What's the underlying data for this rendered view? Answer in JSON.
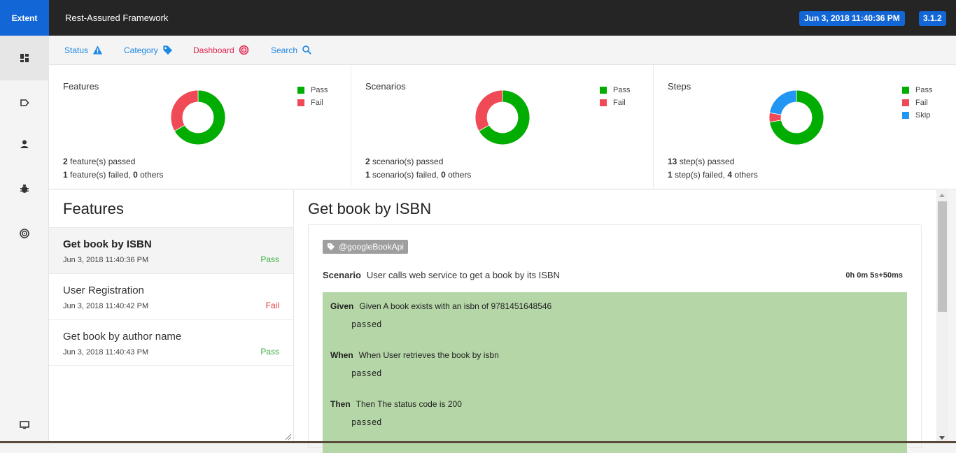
{
  "header": {
    "brand": "Extent",
    "title": "Rest-Assured Framework",
    "date_badge": "Jun 3, 2018 11:40:36 PM",
    "version_badge": "3.1.2"
  },
  "subnav": {
    "status": "Status",
    "category": "Category",
    "dashboard": "Dashboard",
    "search": "Search"
  },
  "colors": {
    "pass": "#00ad00",
    "fail": "#ef4a55",
    "skip": "#2196f3",
    "accent": "#1366d6",
    "dashboard_link": "#e0224f"
  },
  "dashboard": {
    "cards": [
      {
        "title": "Features",
        "legend": [
          "Pass",
          "Fail"
        ],
        "pass": 2,
        "fail": 1,
        "skip": 0,
        "line1_num": "2",
        "line1_text": " feature(s) passed",
        "line2_num": "1",
        "line2_mid": " feature(s) failed, ",
        "line2_others": "0",
        "line2_end": " others"
      },
      {
        "title": "Scenarios",
        "legend": [
          "Pass",
          "Fail"
        ],
        "pass": 2,
        "fail": 1,
        "skip": 0,
        "line1_num": "2",
        "line1_text": " scenario(s) passed",
        "line2_num": "1",
        "line2_mid": " scenario(s) failed, ",
        "line2_others": "0",
        "line2_end": " others"
      },
      {
        "title": "Steps",
        "legend": [
          "Pass",
          "Fail",
          "Skip"
        ],
        "pass": 13,
        "fail": 1,
        "skip": 4,
        "line1_num": "13",
        "line1_text": " step(s) passed",
        "line2_num": "1",
        "line2_mid": " step(s) failed, ",
        "line2_others": "4",
        "line2_end": " others"
      }
    ]
  },
  "features": {
    "heading": "Features",
    "items": [
      {
        "name": "Get book by ISBN",
        "time": "Jun 3, 2018 11:40:36 PM",
        "status": "Pass"
      },
      {
        "name": "User Registration",
        "time": "Jun 3, 2018 11:40:42 PM",
        "status": "Fail"
      },
      {
        "name": "Get book by author name",
        "time": "Jun 3, 2018 11:40:43 PM",
        "status": "Pass"
      }
    ]
  },
  "detail": {
    "title": "Get book by ISBN",
    "tag": "@googleBookApi",
    "scenario_label": "Scenario",
    "scenario_text": "User calls web service to get a book by its ISBN",
    "duration": "0h 0m 5s+50ms",
    "steps": [
      {
        "keyword": "Given",
        "text": "Given A book exists with an isbn of 9781451648546",
        "output": "passed"
      },
      {
        "keyword": "When",
        "text": "When User retrieves the book by isbn",
        "output": "passed"
      },
      {
        "keyword": "Then",
        "text": "Then The status code is 200",
        "output": "passed"
      }
    ]
  },
  "icons": {
    "sidebar": [
      "dashboard-icon",
      "tag-icon",
      "user-icon",
      "bug-icon",
      "radar-icon",
      "monitor-icon"
    ],
    "subnav": [
      "warning-icon",
      "tag-icon",
      "radar-icon",
      "search-icon"
    ]
  }
}
